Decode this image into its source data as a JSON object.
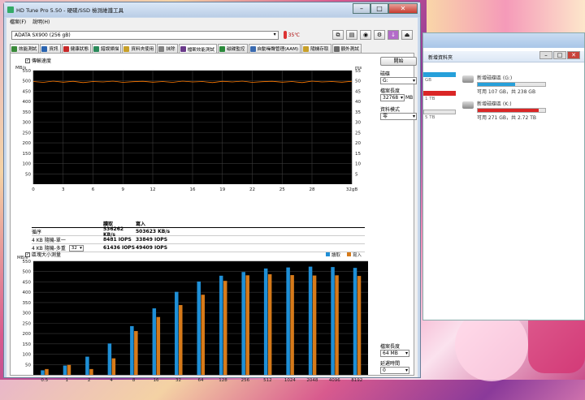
{
  "window": {
    "title": "HD Tune Pro 5.50 - 硬碟/SSD 檢測維護工具",
    "minimize_label": "–",
    "maximize_label": "□",
    "close_label": "✕"
  },
  "menu": {
    "items": [
      "檔案(F)",
      "說明(H)"
    ]
  },
  "device": {
    "selected": "ADATA  SX900 (256 gB)",
    "temperature": "35℃"
  },
  "tabs": [
    {
      "label": "效能測試",
      "color": "#3a8a3a"
    },
    {
      "label": "資訊",
      "color": "#2a64b0"
    },
    {
      "label": "健康狀態",
      "color": "#c82828"
    },
    {
      "label": "錯誤掃描",
      "color": "#2a8a5a"
    },
    {
      "label": "資料夾使用",
      "color": "#c8a028"
    },
    {
      "label": "抹除",
      "color": "#808080"
    },
    {
      "label": "檔案效能測試",
      "color": "#6a3a8a"
    },
    {
      "label": "磁碟監控",
      "color": "#2a8a3a"
    },
    {
      "label": "自動噪聲管理(AAM)",
      "color": "#3a6ab0"
    },
    {
      "label": "隨機存取",
      "color": "#c8a028"
    },
    {
      "label": "額外測試",
      "color": "#6a6a6a"
    }
  ],
  "file_benchmark": {
    "transfer_rate_checkbox": "傳輸速度",
    "unit_left": "MB/s",
    "unit_right": "ms",
    "y_ticks_left": [
      "550",
      "500",
      "450",
      "400",
      "350",
      "300",
      "250",
      "200",
      "150",
      "100",
      "50"
    ],
    "y_ticks_right": [
      "55",
      "50",
      "45",
      "40",
      "35",
      "30",
      "25",
      "20",
      "15",
      "10",
      "5"
    ],
    "x_ticks": [
      "0",
      "3",
      "6",
      "9",
      "12",
      "16",
      "19",
      "22",
      "25",
      "28",
      "32gB"
    ],
    "start_button": "開始",
    "drive_label": "磁碟",
    "drive_value": "G:",
    "file_length_label": "檔案長度",
    "file_length_value": "32768",
    "file_length_unit": "MB",
    "pattern_label": "資料模式",
    "pattern_value": "零",
    "results": {
      "col_read": "讀取",
      "col_write": "寫入",
      "rows": [
        {
          "label": "循序",
          "read": "536262 KB/s",
          "write": "503623 KB/s"
        },
        {
          "label": "4 KB 隨機-單一",
          "read": "8481 IOPS",
          "write": "33849 IOPS"
        },
        {
          "label": "4 KB 隨機-多重",
          "queue": "32",
          "read": "61436 IOPS",
          "write": "49409 IOPS"
        }
      ]
    },
    "block_size_checkbox": "區塊大小測量",
    "block_file_length_label": "檔案長度",
    "block_file_length_value": "64 MB",
    "delay_label": "延遲時間",
    "delay_value": "0"
  },
  "chart_data": [
    {
      "type": "line",
      "title": "",
      "xlabel": "",
      "ylabel": "MB/s",
      "x_range": [
        0,
        32
      ],
      "ylim": [
        0,
        550
      ],
      "y2label": "ms",
      "y2lim": [
        0,
        55
      ],
      "series": [
        {
          "name": "read",
          "color": "#ff7a00",
          "values": [
            497,
            493,
            499,
            494,
            498,
            492,
            497,
            495,
            499,
            493,
            496,
            498,
            494,
            497,
            493,
            499,
            495,
            497,
            492,
            498,
            495,
            499,
            493,
            496,
            498,
            494,
            497,
            492,
            499,
            495,
            497,
            494,
            498
          ]
        }
      ]
    },
    {
      "type": "bar",
      "title": "",
      "xlabel": "",
      "ylabel": "MB/s",
      "ylim": [
        0,
        550
      ],
      "categories": [
        "0.5",
        "1",
        "2",
        "4",
        "8",
        "16",
        "32",
        "64",
        "128",
        "256",
        "512",
        "1024",
        "2048",
        "4096",
        "8192"
      ],
      "series": [
        {
          "name": "讀取",
          "color": "#1f8fd6",
          "values": [
            22,
            45,
            88,
            152,
            236,
            322,
            402,
            452,
            480,
            498,
            515,
            520,
            524,
            522,
            518
          ]
        },
        {
          "name": "寫入",
          "color": "#d67a1a",
          "values": [
            28,
            48,
            28,
            80,
            212,
            280,
            338,
            388,
            455,
            482,
            487,
            483,
            481,
            482,
            479
          ]
        }
      ]
    }
  ],
  "explorer": {
    "toolbar_item": "新增資料夾",
    "drives": [
      {
        "name": "新增磁碟區 (G:)",
        "info": "可用 107 GB，共 238 GB",
        "fill": 0.55,
        "color": "#26a0da"
      },
      {
        "name": "新增磁碟區 (K:)",
        "info": "可用 271 GB，共 2.72 TB",
        "fill": 0.9,
        "color": "#da2626"
      }
    ],
    "left_labels": [
      "GB",
      "1 TB",
      "5 TB"
    ]
  }
}
